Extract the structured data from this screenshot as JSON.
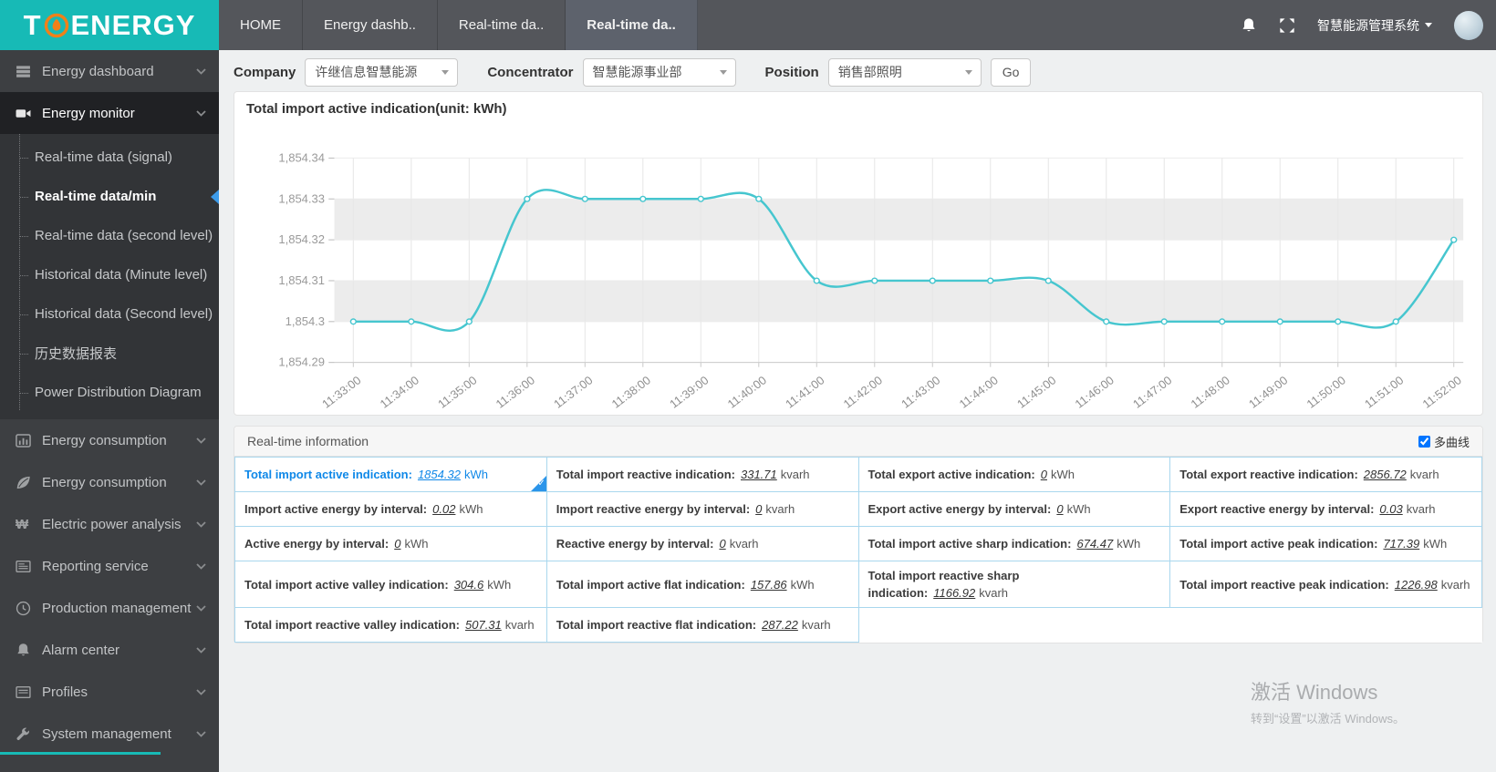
{
  "header": {
    "logo_t": "T",
    "logo_rest": "ENERGY",
    "tabs": [
      {
        "label": "HOME",
        "active": false
      },
      {
        "label": "Energy dashb..",
        "active": false
      },
      {
        "label": "Real-time da..",
        "active": false
      },
      {
        "label": "Real-time da..",
        "active": true
      }
    ],
    "system_title": "智慧能源管理系统"
  },
  "sidebar": {
    "items": [
      {
        "label": "Energy dashboard",
        "icon": "dashboard-icon",
        "active": false
      },
      {
        "label": "Energy monitor",
        "icon": "video-camera-icon",
        "active": true,
        "children": [
          {
            "label": "Real-time data (signal)",
            "active": false
          },
          {
            "label": "Real-time data/min",
            "active": true
          },
          {
            "label": "Real-time data (second level)",
            "active": false
          },
          {
            "label": "Historical data (Minute level)",
            "active": false
          },
          {
            "label": "Historical data (Second level)",
            "active": false
          },
          {
            "label": "历史数据报表",
            "active": false
          },
          {
            "label": "Power Distribution Diagram",
            "active": false
          }
        ]
      },
      {
        "label": "Energy consumption",
        "icon": "bar-chart-icon",
        "active": false
      },
      {
        "label": "Energy consumption",
        "icon": "leaf-icon",
        "active": false
      },
      {
        "label": "Electric power analysis",
        "icon": "won-sign-icon",
        "active": false
      },
      {
        "label": "Reporting service",
        "icon": "report-icon",
        "active": false
      },
      {
        "label": "Production management",
        "icon": "clock-icon",
        "active": false
      },
      {
        "label": "Alarm center",
        "icon": "bell-icon",
        "active": false
      },
      {
        "label": "Profiles",
        "icon": "document-icon",
        "active": false
      },
      {
        "label": "System management",
        "icon": "wrench-icon",
        "active": false,
        "underline": true
      }
    ]
  },
  "filters": {
    "company_label": "Company",
    "company_value": "许继信息智慧能源",
    "concentrator_label": "Concentrator",
    "concentrator_value": "智慧能源事业部",
    "position_label": "Position",
    "position_value": "销售部照明",
    "go_label": "Go"
  },
  "chart_data": {
    "type": "line",
    "title": "Total import active indication(unit: kWh)",
    "x": [
      "11:33:00",
      "11:34:00",
      "11:35:00",
      "11:36:00",
      "11:37:00",
      "11:38:00",
      "11:39:00",
      "11:40:00",
      "11:41:00",
      "11:42:00",
      "11:43:00",
      "11:44:00",
      "11:45:00",
      "11:46:00",
      "11:47:00",
      "11:48:00",
      "11:49:00",
      "11:50:00",
      "11:51:00",
      "11:52:00"
    ],
    "series": [
      {
        "name": "Total import active indication",
        "values": [
          1854.3,
          1854.3,
          1854.3,
          1854.33,
          1854.33,
          1854.33,
          1854.33,
          1854.33,
          1854.31,
          1854.31,
          1854.31,
          1854.31,
          1854.31,
          1854.3,
          1854.3,
          1854.3,
          1854.3,
          1854.3,
          1854.3,
          1854.32
        ]
      }
    ],
    "ylim": [
      1854.29,
      1854.34
    ],
    "ytick_labels": [
      "1,854.34",
      "1,854.33",
      "1,854.32",
      "1,854.31",
      "1,854.3",
      "1,854.29"
    ],
    "grid": true,
    "legend": "none",
    "line_color": "#46c6cf",
    "band_color": "#ececec"
  },
  "realtime": {
    "panel_title": "Real-time information",
    "multi_curve_label": "多曲线",
    "multi_curve_checked": true,
    "rows": [
      [
        {
          "label": "Total import active indication:",
          "value": "1854.32",
          "unit": "kWh",
          "highlight": true
        },
        {
          "label": "Total import reactive indication:",
          "value": "331.71",
          "unit": "kvarh"
        },
        {
          "label": "Total export active indication:",
          "value": "0",
          "unit": "kWh"
        },
        {
          "label": "Total export reactive indication:",
          "value": "2856.72",
          "unit": "kvarh"
        }
      ],
      [
        {
          "label": "Import active energy by interval:",
          "value": "0.02",
          "unit": "kWh"
        },
        {
          "label": "Import reactive energy by interval:",
          "value": "0",
          "unit": "kvarh"
        },
        {
          "label": "Export active energy by interval:",
          "value": "0",
          "unit": "kWh"
        },
        {
          "label": "Export reactive energy by interval:",
          "value": "0.03",
          "unit": "kvarh"
        }
      ],
      [
        {
          "label": "Active energy by interval:",
          "value": "0",
          "unit": "kWh"
        },
        {
          "label": "Reactive energy by interval:",
          "value": "0",
          "unit": "kvarh"
        },
        {
          "label": "Total import active sharp indication:",
          "value": "674.47",
          "unit": "kWh"
        },
        {
          "label": "Total import active peak indication:",
          "value": "717.39",
          "unit": "kWh"
        }
      ],
      [
        {
          "label": "Total import active valley indication:",
          "value": "304.6",
          "unit": "kWh"
        },
        {
          "label": "Total import active flat indication:",
          "value": "157.86",
          "unit": "kWh"
        },
        {
          "label": "Total import reactive sharp indication:",
          "value": "1166.92",
          "unit": "kvarh"
        },
        {
          "label": "Total import reactive peak indication:",
          "value": "1226.98",
          "unit": "kvarh"
        }
      ],
      [
        {
          "label": "Total import reactive valley indication:",
          "value": "507.31",
          "unit": "kvarh"
        },
        {
          "label": "Total import reactive flat indication:",
          "value": "287.22",
          "unit": "kvarh"
        },
        {},
        {}
      ]
    ]
  },
  "watermark": {
    "line1": "激活 Windows",
    "line2": "转到“设置”以激活 Windows。"
  }
}
